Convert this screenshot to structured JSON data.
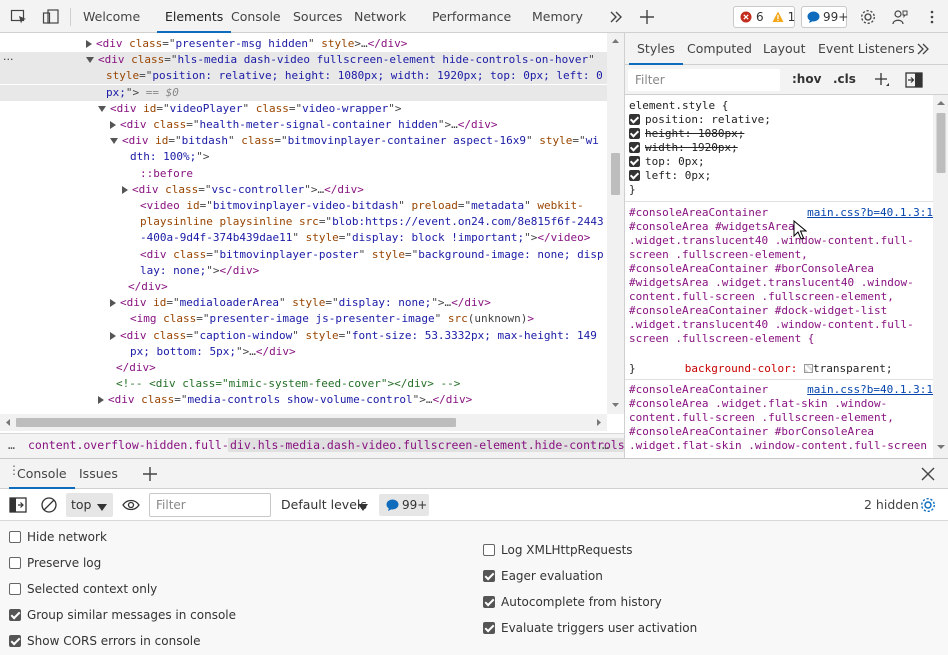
{
  "toolbar": {
    "tabs": [
      "Welcome",
      "Elements",
      "Console",
      "Sources",
      "Network",
      "Performance",
      "Memory"
    ],
    "errors_count": "6",
    "warnings_count": "1",
    "messages_count": "99+"
  },
  "dom": {
    "lines": [
      {
        "indent": 96,
        "tri": "r",
        "html": [
          [
            "tg",
            "<div "
          ],
          [
            "at",
            "class"
          ],
          [
            "pl",
            "=\""
          ],
          [
            "av",
            "presenter-msg hidden"
          ],
          [
            "pl",
            "\" "
          ],
          [
            "at",
            "style"
          ],
          [
            "pl",
            ">…"
          ],
          [
            "tg",
            "</div>"
          ]
        ]
      },
      {
        "indent": 96,
        "tri": "d",
        "sel": true,
        "html": [
          [
            "tg",
            "<div "
          ],
          [
            "at",
            "class"
          ],
          [
            "pl",
            "=\""
          ],
          [
            "av",
            "hls-media dash-video fullscreen-element hide-controls-on-hover"
          ],
          [
            "pl",
            "\""
          ]
        ]
      },
      {
        "indent": 106,
        "html": [
          [
            "at",
            "style"
          ],
          [
            "pl",
            "=\""
          ],
          [
            "av",
            "position: relative; height: 1080px; width: 1920px; top: 0px; left: 0"
          ]
        ],
        "sel": true
      },
      {
        "indent": 106,
        "html": [
          [
            "av",
            "px;"
          ],
          [
            "pl",
            "\">"
          ],
          [
            "gr",
            " == $0"
          ]
        ],
        "sel": true
      },
      {
        "indent": 108,
        "tri": "d",
        "html": [
          [
            "tg",
            "<div "
          ],
          [
            "at",
            "id"
          ],
          [
            "pl",
            "=\""
          ],
          [
            "av",
            "videoPlayer"
          ],
          [
            "pl",
            "\" "
          ],
          [
            "at",
            "class"
          ],
          [
            "pl",
            "=\""
          ],
          [
            "av",
            "video-wrapper"
          ],
          [
            "pl",
            "\">"
          ]
        ]
      },
      {
        "indent": 120,
        "tri": "r",
        "html": [
          [
            "tg",
            "<div "
          ],
          [
            "at",
            "class"
          ],
          [
            "pl",
            "=\""
          ],
          [
            "av",
            "health-meter-signal-container hidden"
          ],
          [
            "pl",
            "\">…"
          ],
          [
            "tg",
            "</div>"
          ]
        ]
      },
      {
        "indent": 120,
        "tri": "d",
        "html": [
          [
            "tg",
            "<div "
          ],
          [
            "at",
            "id"
          ],
          [
            "pl",
            "=\""
          ],
          [
            "av",
            "bitdash"
          ],
          [
            "pl",
            "\" "
          ],
          [
            "at",
            "class"
          ],
          [
            "pl",
            "=\""
          ],
          [
            "av",
            "bitmovinplayer-container aspect-16x9"
          ],
          [
            "pl",
            "\" "
          ],
          [
            "at",
            "style"
          ],
          [
            "pl",
            "=\""
          ],
          [
            "av",
            "wi"
          ]
        ]
      },
      {
        "indent": 130,
        "html": [
          [
            "av",
            "dth: 100%;"
          ],
          [
            "pl",
            "\">"
          ]
        ]
      },
      {
        "indent": 140,
        "html": [
          [
            "tg",
            "::before"
          ]
        ]
      },
      {
        "indent": 132,
        "tri": "r",
        "html": [
          [
            "tg",
            "<div "
          ],
          [
            "at",
            "class"
          ],
          [
            "pl",
            "=\""
          ],
          [
            "av",
            "vsc-controller"
          ],
          [
            "pl",
            "\">…"
          ],
          [
            "tg",
            "</div>"
          ]
        ]
      },
      {
        "indent": 140,
        "html": [
          [
            "tg",
            "<video "
          ],
          [
            "at",
            "id"
          ],
          [
            "pl",
            "=\""
          ],
          [
            "av",
            "bitmovinplayer-video-bitdash"
          ],
          [
            "pl",
            "\" "
          ],
          [
            "at",
            "preload"
          ],
          [
            "pl",
            "=\""
          ],
          [
            "av",
            "metadata"
          ],
          [
            "pl",
            "\" "
          ],
          [
            "at",
            "webkit-"
          ]
        ]
      },
      {
        "indent": 140,
        "html": [
          [
            "at",
            "playsinline playsinline src"
          ],
          [
            "pl",
            "=\""
          ],
          [
            "av",
            "blob:https://event.on24.com/8e815f6f-2443"
          ]
        ]
      },
      {
        "indent": 140,
        "html": [
          [
            "av",
            "-400a-9d4f-374b439dae11"
          ],
          [
            "pl",
            "\" "
          ],
          [
            "at",
            "style"
          ],
          [
            "pl",
            "=\""
          ],
          [
            "av",
            "display: block !important;"
          ],
          [
            "pl",
            "\">"
          ],
          [
            "tg",
            "</video>"
          ]
        ]
      },
      {
        "indent": 140,
        "html": [
          [
            "tg",
            "<div "
          ],
          [
            "at",
            "class"
          ],
          [
            "pl",
            "=\""
          ],
          [
            "av",
            "bitmovinplayer-poster"
          ],
          [
            "pl",
            "\" "
          ],
          [
            "at",
            "style"
          ],
          [
            "pl",
            "=\""
          ],
          [
            "av",
            "background-image: none; disp"
          ]
        ]
      },
      {
        "indent": 140,
        "html": [
          [
            "av",
            "lay: none;"
          ],
          [
            "pl",
            "\">"
          ],
          [
            "tg",
            "</div>"
          ]
        ]
      },
      {
        "indent": 128,
        "html": [
          [
            "tg",
            "</div>"
          ]
        ]
      },
      {
        "indent": 120,
        "tri": "r",
        "html": [
          [
            "tg",
            "<div "
          ],
          [
            "at",
            "id"
          ],
          [
            "pl",
            "=\""
          ],
          [
            "av",
            "medialoaderArea"
          ],
          [
            "pl",
            "\" "
          ],
          [
            "at",
            "style"
          ],
          [
            "pl",
            "=\""
          ],
          [
            "av",
            "display: none;"
          ],
          [
            "pl",
            "\">…"
          ],
          [
            "tg",
            "</div>"
          ]
        ]
      },
      {
        "indent": 130,
        "html": [
          [
            "tg",
            "<img "
          ],
          [
            "at",
            "class"
          ],
          [
            "pl",
            "=\""
          ],
          [
            "av",
            "presenter-image js-presenter-image"
          ],
          [
            "pl",
            "\" "
          ],
          [
            "at",
            "src"
          ],
          [
            "pl",
            "(unknown)"
          ],
          [
            "tg",
            ">"
          ]
        ]
      },
      {
        "indent": 120,
        "tri": "r",
        "html": [
          [
            "tg",
            "<div "
          ],
          [
            "at",
            "class"
          ],
          [
            "pl",
            "=\""
          ],
          [
            "av",
            "caption-window"
          ],
          [
            "pl",
            "\" "
          ],
          [
            "at",
            "style"
          ],
          [
            "pl",
            "=\""
          ],
          [
            "av",
            "font-size: 53.3332px; max-height: 149"
          ]
        ]
      },
      {
        "indent": 130,
        "html": [
          [
            "av",
            "px; bottom: 5px;"
          ],
          [
            "pl",
            "\">…"
          ],
          [
            "tg",
            "</div>"
          ]
        ]
      },
      {
        "indent": 116,
        "html": [
          [
            "tg",
            "</div>"
          ]
        ]
      },
      {
        "indent": 116,
        "html": [
          [
            "cm",
            "<!-- <div class=\"mimic-system-feed-cover\"></div> -->"
          ]
        ]
      },
      {
        "indent": 108,
        "tri": "r",
        "html": [
          [
            "tg",
            "<div "
          ],
          [
            "at",
            "class"
          ],
          [
            "pl",
            "=\""
          ],
          [
            "av",
            "media-controls show-volume-control"
          ],
          [
            "pl",
            "\">…"
          ],
          [
            "tg",
            "</div>"
          ]
        ]
      }
    ]
  },
  "breadcrumb": {
    "item1": "content.overflow-hidden.full-screen",
    "item2": "div.hls-media.dash-video.fullscreen-element.hide-controls-on-hover"
  },
  "styles": {
    "tabs": [
      "Styles",
      "Computed",
      "Layout",
      "Event Listeners"
    ],
    "filter_placeholder": "Filter",
    "hov": ":hov",
    "cls": ".cls",
    "element_style": "element.style {",
    "props": [
      {
        "text": "position: relative;",
        "strike": false
      },
      {
        "text": "height: 1080px;",
        "strike": true
      },
      {
        "text": "width: 1920px;",
        "strike": true
      },
      {
        "text": "top: 0px;",
        "strike": false
      },
      {
        "text": "left: 0px;",
        "strike": false
      }
    ],
    "rule1_selectors": [
      "#consoleAreaContainer",
      "#consoleArea #widgetsArea",
      ".widget.translucent40 .window-content.full-",
      "screen .fullscreen-element,",
      "#consoleAreaContainer #borConsoleArea",
      "#widgetsArea .widget.translucent40 .window-",
      "content.full-screen .fullscreen-element,",
      "#consoleAreaContainer #dock-widget-list",
      ".widget.translucent40 .window-content.full-",
      "screen .fullscreen-element {"
    ],
    "rule1_link": "main.css?b=40.1.3:1",
    "rule1_prop": "background-color:",
    "rule1_value": "transparent;",
    "rule2_selectors": [
      "#consoleAreaContainer",
      "#consoleArea .widget.flat-skin .window-",
      "content.full-screen .fullscreen-element,",
      "#consoleAreaContainer #borConsoleArea",
      ".widget.flat-skin .window-content.full-screen"
    ],
    "rule2_link": "main.css?b=40.1.3:1",
    "brace_close": "}"
  },
  "drawer": {
    "tabs": [
      "Console",
      "Issues"
    ],
    "context": "top",
    "filter_placeholder": "Filter",
    "levels": "Default levels",
    "messages_count": "99+",
    "hidden": "2 hidden",
    "left_options": [
      {
        "label": "Hide network",
        "checked": false
      },
      {
        "label": "Preserve log",
        "checked": false
      },
      {
        "label": "Selected context only",
        "checked": false
      },
      {
        "label": "Group similar messages in console",
        "checked": true
      },
      {
        "label": "Show CORS errors in console",
        "checked": true
      }
    ],
    "right_options": [
      {
        "label": "Log XMLHttpRequests",
        "checked": false
      },
      {
        "label": "Eager evaluation",
        "checked": true
      },
      {
        "label": "Autocomplete from history",
        "checked": true
      },
      {
        "label": "Evaluate triggers user activation",
        "checked": true
      }
    ]
  },
  "colors": {
    "accent": "#0f6cbd",
    "error": "#c42b1c",
    "warning": "#f3a71b",
    "info": "#0f6cbd"
  }
}
